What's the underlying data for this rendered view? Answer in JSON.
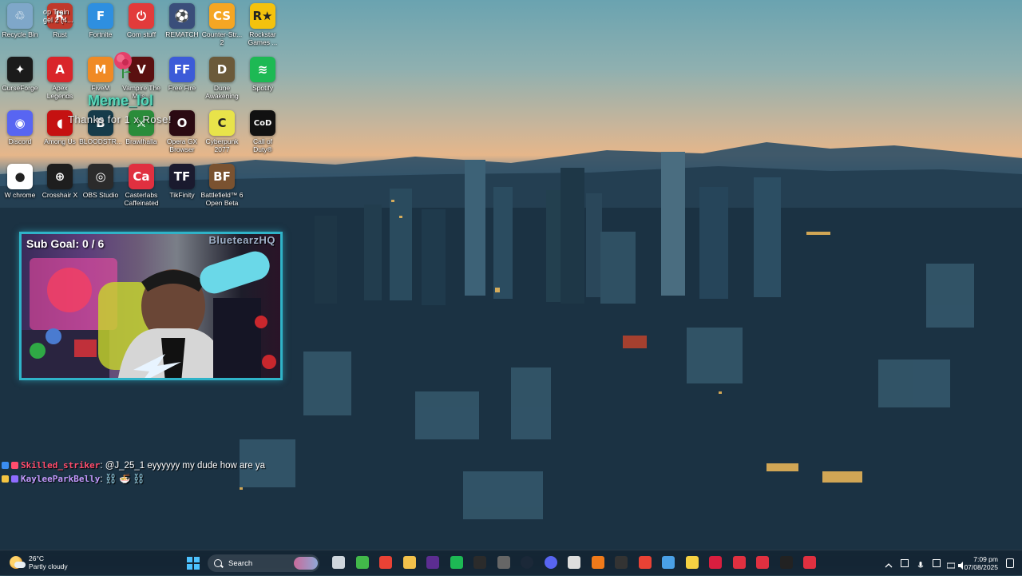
{
  "desktop": {
    "icons": [
      {
        "label": "Recycle Bin",
        "color": "#7fa7c9",
        "glyph": "♲"
      },
      {
        "label": "Rust",
        "color": "#c0392b",
        "glyph": "R"
      },
      {
        "label": "Fortnite",
        "color": "#2e8fe0",
        "glyph": "F"
      },
      {
        "label": "Com stuff",
        "color": "#e23b3b",
        "glyph": "⏻"
      },
      {
        "label": "REMATCH",
        "color": "#3a4e7a",
        "glyph": "⚽"
      },
      {
        "label": "Counter-Str...\n2",
        "color": "#f5a623",
        "glyph": "CS"
      },
      {
        "label": "Rockstar\nGames ...",
        "color": "#f4c20d",
        "glyph": "R★"
      },
      {
        "label": "CurseForge",
        "color": "#1b1b1b",
        "glyph": "✦"
      },
      {
        "label": "Apex\nLegends",
        "color": "#d9252a",
        "glyph": "A"
      },
      {
        "label": "FiveM",
        "color": "#f08a24",
        "glyph": "M"
      },
      {
        "label": "Vampire The\nMas...",
        "color": "#5a1010",
        "glyph": "V"
      },
      {
        "label": "Free Fire",
        "color": "#3c5bd8",
        "glyph": "FF"
      },
      {
        "label": "Dune\nAwakening",
        "color": "#6b5a3a",
        "glyph": "D"
      },
      {
        "label": "Spotify",
        "color": "#1db954",
        "glyph": "≋"
      },
      {
        "label": "Discord",
        "color": "#5865f2",
        "glyph": "◉"
      },
      {
        "label": "Among Us",
        "color": "#c51111",
        "glyph": "◖"
      },
      {
        "label": "BLOODSTR...",
        "color": "#163b4a",
        "glyph": "B"
      },
      {
        "label": "Brawlhalla",
        "color": "#2a8c3a",
        "glyph": "⚔"
      },
      {
        "label": "Opera GX\nBrowser",
        "color": "#2b0a12",
        "glyph": "O"
      },
      {
        "label": "Cyberpunk\n2077",
        "color": "#e8e34a",
        "glyph": "C"
      },
      {
        "label": "Call of\nDuty®",
        "color": "#111111",
        "glyph": "CoD"
      },
      {
        "label": "W chrome",
        "color": "#ffffff",
        "glyph": "●"
      },
      {
        "label": "Crosshair X",
        "color": "#1e1e1e",
        "glyph": "⊕"
      },
      {
        "label": "OBS Studio",
        "color": "#2b2b2b",
        "glyph": "◎"
      },
      {
        "label": "Casterlabs\nCaffeinated",
        "color": "#e03040",
        "glyph": "Ca"
      },
      {
        "label": "TikFinity",
        "color": "#1a1a2e",
        "glyph": "TF"
      },
      {
        "label": "Battlefield™ 6\nOpen Beta",
        "color": "#7a5230",
        "glyph": "BF"
      }
    ],
    "partial_icon_text": "op Train\ngel 2 (4..."
  },
  "overlay": {
    "name": "Meme_lol",
    "thanks": "Thanks for 1 x Rose!"
  },
  "webcam": {
    "sub_goal": "Sub Goal: 0 / 6",
    "handle": "BluetearzHQ"
  },
  "chat": [
    {
      "user": "Skilled_striker",
      "message": ": @J_25_1 eyyyyyy my dude how are ya",
      "color": "#ff4d6d"
    },
    {
      "user": "KayleeParkBelly",
      "message": ": ⛓️ 🍜 ⛓️",
      "color": "#c49bff"
    }
  ],
  "taskbar": {
    "weather_temp": "26°C",
    "weather_desc": "Partly cloudy",
    "search_label": "Search",
    "apps": [
      "file-explorer",
      "xbox",
      "chrome",
      "folder",
      "visual-studio",
      "spotify",
      "epic-games",
      "settings",
      "steam",
      "discord",
      "notepad",
      "vlc",
      "obs",
      "chrome-2",
      "photos",
      "sticky-notes",
      "opera-gx",
      "casterlabs",
      "casterlabs-2",
      "tikfinity",
      "casterlabs-3"
    ],
    "clock_time": "7:09 pm",
    "clock_date": "07/08/2025"
  },
  "colors": {
    "accent": "#2fb3c8",
    "overlay_name": "#58d6b8",
    "start_blue": "#4cc2ff"
  }
}
